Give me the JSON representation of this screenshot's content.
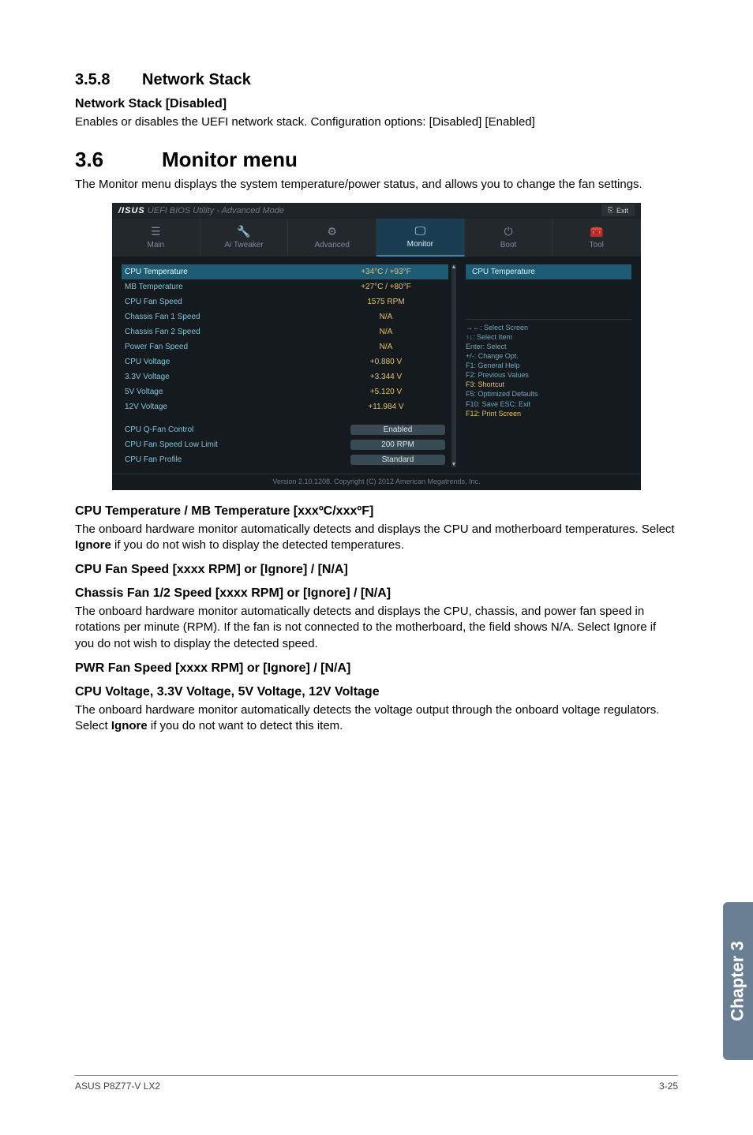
{
  "sec358": {
    "num": "3.5.8",
    "title": "Network Stack",
    "sub1": "Network Stack [Disabled]",
    "body1": "Enables or disables the UEFI network stack. Configuration options: [Disabled] [Enabled]"
  },
  "sec36": {
    "num": "3.6",
    "title": "Monitor menu",
    "intro": "The Monitor menu displays the system temperature/power status, and allows you to change the fan settings."
  },
  "bios": {
    "brand": "/ISUS",
    "title_suffix": " UEFI BIOS Utility - Advanced Mode",
    "exit": "Exit",
    "tabs": {
      "main": "Main",
      "aitweaker": "Ai Tweaker",
      "advanced": "Advanced",
      "monitor": "Monitor",
      "boot": "Boot",
      "tool": "Tool"
    },
    "rows": {
      "cpu_temp_l": "CPU Temperature",
      "cpu_temp_v": "+34°C / +93°F",
      "mb_temp_l": "MB Temperature",
      "mb_temp_v": "+27°C / +80°F",
      "cpu_fan_l": "CPU Fan Speed",
      "cpu_fan_v": "1575 RPM",
      "ch1_l": "Chassis Fan 1 Speed",
      "ch1_v": "N/A",
      "ch2_l": "Chassis Fan 2 Speed",
      "ch2_v": "N/A",
      "pwr_l": "Power Fan Speed",
      "pwr_v": "N/A",
      "cpu_v_l": "CPU Voltage",
      "cpu_v_v": "+0.880 V",
      "v33_l": "3.3V Voltage",
      "v33_v": "+3.344 V",
      "v5_l": "5V Voltage",
      "v5_v": "+5.120 V",
      "v12_l": "12V Voltage",
      "v12_v": "+11.984 V",
      "qfan_l": "CPU Q-Fan Control",
      "qfan_v": "Enabled",
      "low_l": "CPU Fan Speed Low Limit",
      "low_v": "200 RPM",
      "prof_l": "CPU Fan Profile",
      "prof_v": "Standard"
    },
    "help_title": "CPU Temperature",
    "keys": {
      "l1": "→←: Select Screen",
      "l2": "↑↓: Select Item",
      "l3": "Enter: Select",
      "l4": "+/-: Change Opt.",
      "l5": "F1: General Help",
      "l6": "F2: Previous Values",
      "l7": "F3: Shortcut",
      "l8": "F5: Optimized Defaults",
      "l9": "F10: Save  ESC: Exit",
      "l10": "F12: Print Screen"
    },
    "footer": "Version 2.10.1208. Copyright (C) 2012 American Megatrends, Inc."
  },
  "subs": {
    "s1": "CPU Temperature / MB Temperature [xxxºC/xxxºF]",
    "b1a": "The onboard hardware monitor automatically detects and displays the CPU and motherboard temperatures. Select ",
    "b1b": "Ignore",
    "b1c": " if you do not wish to display the detected temperatures.",
    "s2": "CPU Fan Speed [xxxx RPM] or [Ignore] / [N/A]",
    "s3": "Chassis Fan 1/2 Speed [xxxx RPM] or [Ignore] / [N/A]",
    "b3": "The onboard hardware monitor automatically detects and displays the CPU, chassis, and power fan speed in rotations per minute (RPM). If the fan is not connected to the motherboard, the field shows N/A. Select Ignore if you do not wish to display the detected speed.",
    "s4": "PWR Fan Speed [xxxx RPM] or [Ignore] / [N/A]",
    "s5": "CPU Voltage, 3.3V Voltage, 5V Voltage, 12V Voltage",
    "b5a": "The onboard hardware monitor automatically detects the voltage output through the onboard voltage regulators. Select ",
    "b5b": "Ignore",
    "b5c": " if you do not want to detect this item."
  },
  "sidetab": "Chapter 3",
  "footer": {
    "left": "ASUS P8Z77-V LX2",
    "right": "3-25"
  }
}
